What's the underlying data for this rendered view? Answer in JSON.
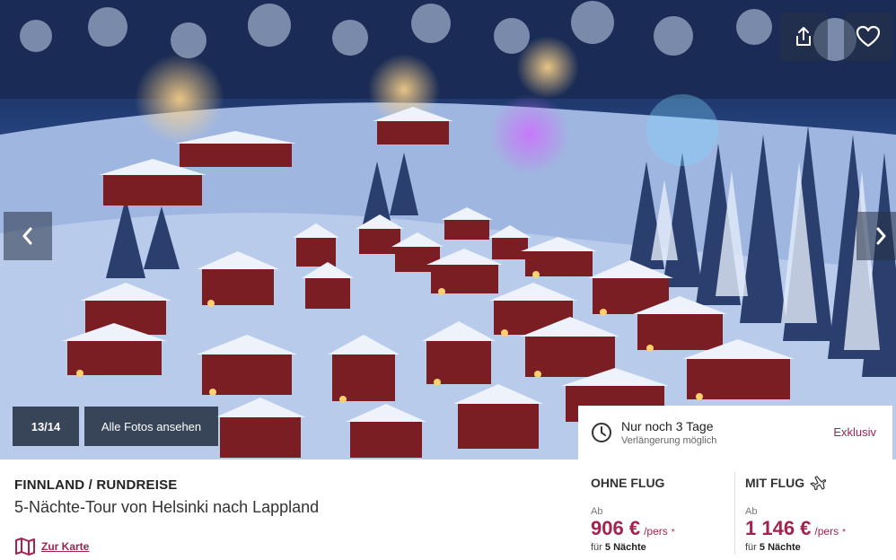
{
  "gallery": {
    "counter": "13/14",
    "all_photos_label": "Alle Fotos ansehen",
    "share_icon": "share-icon",
    "favorite_icon": "heart-icon",
    "prev_icon": "chevron-left-icon",
    "next_icon": "chevron-right-icon"
  },
  "promo": {
    "title": "Nur noch 3 Tage",
    "subtitle": "Verlängerung möglich",
    "badge": "Exklusiv",
    "icon": "clock-icon"
  },
  "tour": {
    "country": "FINNLAND / RUNDREISE",
    "name": "5-Nächte-Tour von Helsinki nach Lappland",
    "map_link": "Zur Karte",
    "map_icon": "map-icon"
  },
  "prices": {
    "without_flight": {
      "label": "OHNE FLUG",
      "from": "Ab",
      "price": "906 €",
      "per": "/pers",
      "asterisk": "*",
      "for": "für",
      "nights": "5 Nächte"
    },
    "with_flight": {
      "label": "MIT FLUG",
      "icon": "airplane-icon",
      "from": "Ab",
      "price": "1 146 €",
      "per": "/pers",
      "asterisk": "*",
      "for": "für",
      "nights": "5 Nächte"
    }
  },
  "colors": {
    "accent": "#a3234f",
    "overlay": "#141e2d"
  }
}
